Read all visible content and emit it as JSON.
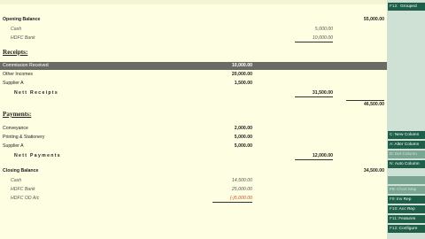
{
  "header": {
    "strip_text": ""
  },
  "opening": {
    "title": "Opening Balance",
    "total": "55,000.00",
    "cash_label": "Cash",
    "cash": "5,000.00",
    "hdfc_label": "HDFC Bank",
    "hdfc": "10,000.00"
  },
  "receipts": {
    "section": "Receipts:",
    "items": [
      {
        "label": "Commission Received",
        "value": "10,000.00"
      },
      {
        "label": "Other Incomes",
        "value": "20,000.00"
      },
      {
        "label": "Supplier A",
        "value": "1,500.00"
      }
    ],
    "nett_label": "Nett Receipts",
    "nett": "31,500.00",
    "running": "46,500.00"
  },
  "payments": {
    "section": "Payments:",
    "items": [
      {
        "label": "Conveyance",
        "value": "2,000.00"
      },
      {
        "label": "Printing & Stationery",
        "value": "5,000.00"
      },
      {
        "label": "Supplier A",
        "value": "5,000.00"
      }
    ],
    "nett_label": "Nett Payments",
    "nett": "12,000.00"
  },
  "closing": {
    "title": "Closing Balance",
    "total": "34,500.00",
    "items": [
      {
        "label": "Cash",
        "value": "14,500.00"
      },
      {
        "label": "HDFC Bank",
        "value": "25,000.00"
      },
      {
        "label": "HDFC OD A/c",
        "value": "(-)5,000.00"
      }
    ]
  },
  "sidebar": {
    "grouped": {
      "key": "F12:",
      "label": "Grouped"
    },
    "buttons": [
      {
        "key": "C:",
        "label": "New Column",
        "disabled": false
      },
      {
        "key": "A:",
        "label": "Alter Column",
        "disabled": false
      },
      {
        "key": "D:",
        "label": "Del Column",
        "disabled": true
      },
      {
        "key": "N:",
        "label": "Auto Column",
        "disabled": false
      },
      {
        "key": "",
        "label": "",
        "disabled": true
      },
      {
        "key": "F8:",
        "label": "Chart Map",
        "disabled": true
      },
      {
        "key": "F9:",
        "label": "Inv Rep",
        "disabled": false
      },
      {
        "key": "F10:",
        "label": "Acc Rep",
        "disabled": false
      },
      {
        "key": "F11:",
        "label": "Features",
        "disabled": false
      },
      {
        "key": "F12:",
        "label": "Configure",
        "disabled": false
      }
    ]
  },
  "colors": {
    "sidebar_button": "#1f5e49",
    "highlight_row": "#6b6b66",
    "background": "#fefee2",
    "negative": "#d04a2a"
  }
}
